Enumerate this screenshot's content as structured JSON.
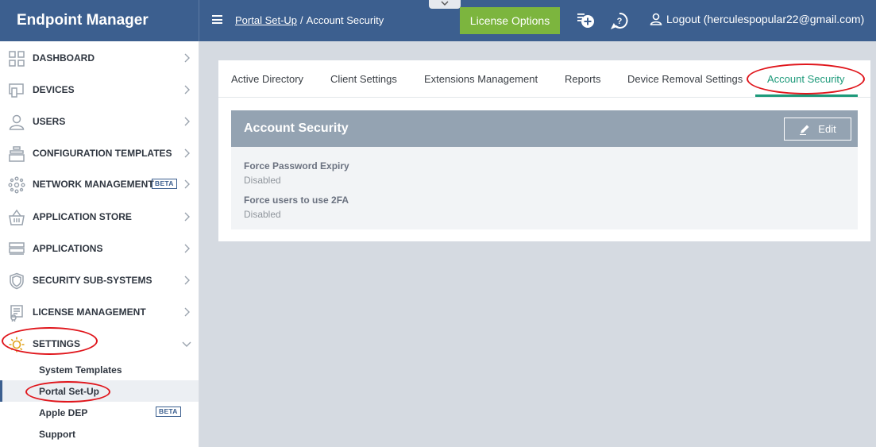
{
  "app": {
    "title": "Endpoint Manager"
  },
  "header": {
    "breadcrumb": {
      "parent": "Portal Set-Up",
      "separator": "/",
      "current": "Account Security"
    },
    "license_button": "License Options",
    "logout_label": "Logout (herculespopular22@gmail.com)"
  },
  "sidebar": {
    "items": [
      {
        "label": "DASHBOARD",
        "icon": "grid-icon"
      },
      {
        "label": "DEVICES",
        "icon": "devices-icon"
      },
      {
        "label": "USERS",
        "icon": "user-icon"
      },
      {
        "label": "CONFIGURATION TEMPLATES",
        "icon": "templates-icon"
      },
      {
        "label": "NETWORK MANAGEMENT",
        "icon": "network-icon",
        "badge": "BETA"
      },
      {
        "label": "APPLICATION STORE",
        "icon": "basket-icon"
      },
      {
        "label": "APPLICATIONS",
        "icon": "applications-icon"
      },
      {
        "label": "SECURITY SUB-SYSTEMS",
        "icon": "shield-icon"
      },
      {
        "label": "LICENSE MANAGEMENT",
        "icon": "license-icon"
      },
      {
        "label": "SETTINGS",
        "icon": "gear-icon"
      }
    ],
    "settings_sub": [
      {
        "label": "System Templates"
      },
      {
        "label": "Portal Set-Up"
      },
      {
        "label": "Apple DEP",
        "badge": "BETA"
      },
      {
        "label": "Support"
      }
    ]
  },
  "main": {
    "tabs": [
      {
        "label": "Active Directory"
      },
      {
        "label": "Client Settings"
      },
      {
        "label": "Extensions Management"
      },
      {
        "label": "Reports"
      },
      {
        "label": "Device Removal Settings"
      },
      {
        "label": "Account Security"
      }
    ],
    "panel": {
      "title": "Account Security",
      "edit_label": "Edit",
      "fields": [
        {
          "label": "Force Password Expiry",
          "value": "Disabled"
        },
        {
          "label": "Force users to use 2FA",
          "value": "Disabled"
        }
      ]
    }
  },
  "colors": {
    "header_bg": "#3c5f8f",
    "license_green": "#7cb53e",
    "active_tab": "#1d9a7a",
    "annotation_red": "#e0161c",
    "panel_header": "#94a3b2"
  }
}
